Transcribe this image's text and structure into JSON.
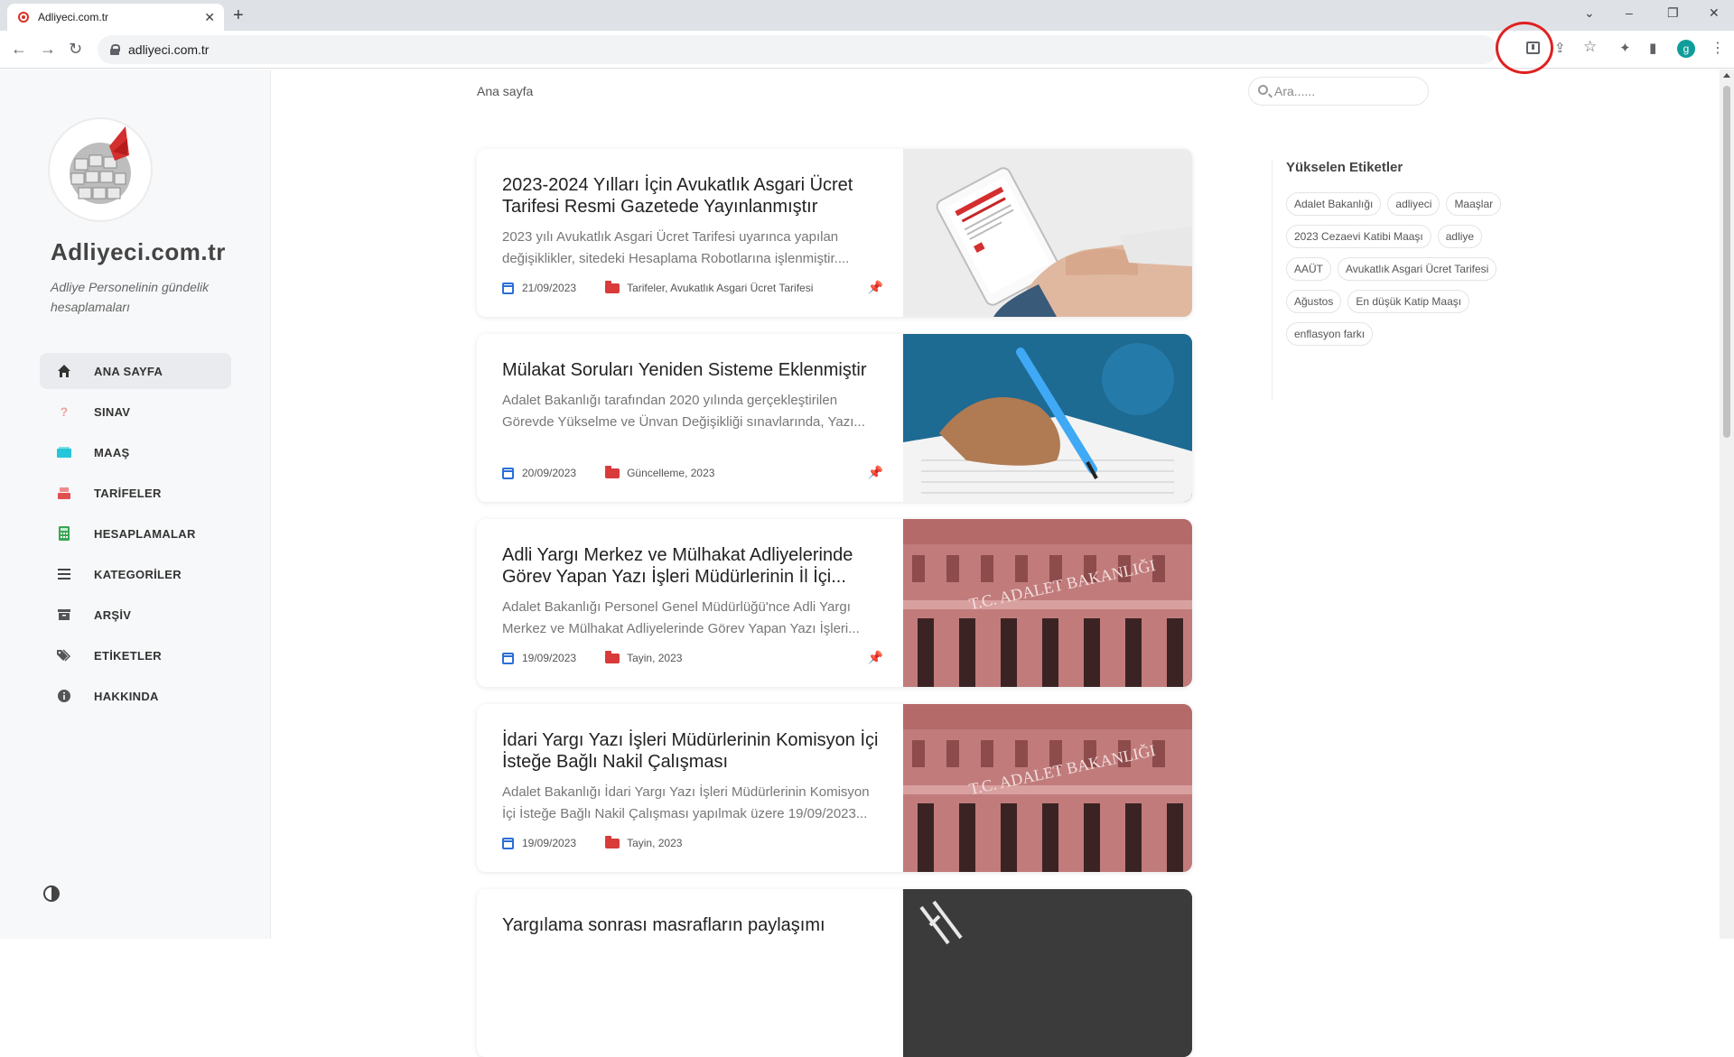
{
  "browser": {
    "tab_title": "Adliyeci.com.tr",
    "tab_close": "✕",
    "new_tab": "+",
    "url": "adliyeci.com.tr",
    "window_controls": {
      "chevron": "⌄",
      "minimize": "–",
      "restore": "❐",
      "close": "✕"
    },
    "nav": {
      "back": "←",
      "forward": "→",
      "reload": "↻"
    },
    "toolbar_icons": {
      "share": "⇪",
      "star": "☆",
      "extensions": "✦",
      "sidepanel": "▮",
      "menu": "⋮"
    },
    "profile_initial": "g",
    "highlight_color": "#e02020"
  },
  "sidebar": {
    "site_name": "Adliyeci.com.tr",
    "site_description": "Adliye Personelinin gündelik hesaplamaları",
    "menu": [
      {
        "label": "ANA SAYFA",
        "icon": "home-icon",
        "glyph": "⌂",
        "color": "#333333",
        "active": true
      },
      {
        "label": "SINAV",
        "icon": "question-icon",
        "glyph": "?",
        "color": "#f2a0a0",
        "active": false
      },
      {
        "label": "MAAŞ",
        "icon": "money-icon",
        "glyph": "▬",
        "color": "#26c6da",
        "active": false
      },
      {
        "label": "TARİFELER",
        "icon": "cash-register-icon",
        "glyph": "▤",
        "color": "#e05050",
        "active": false
      },
      {
        "label": "HESAPLAMALAR",
        "icon": "calculator-icon",
        "glyph": "▦",
        "color": "#3aa655",
        "active": false
      },
      {
        "label": "KATEGORİLER",
        "icon": "list-icon",
        "glyph": "≡",
        "color": "#444444",
        "active": false
      },
      {
        "label": "ARŞİV",
        "icon": "archive-icon",
        "glyph": "▭",
        "color": "#555555",
        "active": false
      },
      {
        "label": "ETİKETLER",
        "icon": "tags-icon",
        "glyph": "◆",
        "color": "#555555",
        "active": false
      },
      {
        "label": "HAKKINDA",
        "icon": "info-icon",
        "glyph": "i",
        "color": "#555555",
        "active": false
      }
    ]
  },
  "header": {
    "breadcrumb": "Ana sayfa",
    "search_placeholder": "Ara......"
  },
  "posts": [
    {
      "title": "2023-2024 Yılları İçin Avukatlık Asgari Ücret Tarifesi Resmi Gazetede Yayınlanmıştır",
      "excerpt": "2023 yılı Avukatlık Asgari Ücret Tarifesi uyarınca yapılan değişiklikler, sitedeki Hesaplama Robotlarına işlenmiştir....",
      "date": "21/09/2023",
      "categories": "Tarifeler, Avukatlık Asgari Ücret Tarifesi",
      "pinned": true,
      "image": "tablet-gazette"
    },
    {
      "title": "Mülakat Soruları Yeniden Sisteme Eklenmiştir",
      "excerpt": "Adalet Bakanlığı tarafından 2020 yılında gerçekleştirilen Görevde Yükselme ve Ünvan Değişikliği sınavlarında, Yazı...",
      "date": "20/09/2023",
      "categories": "Güncelleme, 2023",
      "pinned": true,
      "image": "hand-writing"
    },
    {
      "title": "Adli Yargı Merkez ve Mülhakat Adliyelerinde Görev Yapan Yazı İşleri Müdürlerinin İl İçi...",
      "excerpt": "Adalet Bakanlığı Personel Genel Müdürlüğü'nce Adli Yargı Merkez ve Mülhakat Adliyelerinde Görev Yapan Yazı İşleri...",
      "date": "19/09/2023",
      "categories": "Tayin, 2023",
      "pinned": true,
      "image": "ministry-building",
      "image_text": "T.C. ADALET BAKANLIĞI"
    },
    {
      "title": "İdari Yargı Yazı İşleri Müdürlerinin Komisyon İçi İsteğe Bağlı Nakil Çalışması",
      "excerpt": "Adalet Bakanlığı İdari Yargı Yazı İşleri Müdürlerinin Komisyon İçi İsteğe Bağlı Nakil Çalışması yapılmak üzere 19/09/2023...",
      "date": "19/09/2023",
      "categories": "Tayin, 2023",
      "pinned": false,
      "image": "ministry-building",
      "image_text": "T.C. ADALET BAKANLIĞI"
    },
    {
      "title": "Yargılama sonrası masrafların paylaşımı",
      "excerpt": "",
      "date": "",
      "categories": "",
      "pinned": false,
      "image": "chalkboard"
    }
  ],
  "aside": {
    "heading": "Yükselen Etiketler",
    "tags": [
      "Adalet Bakanlığı",
      "adliyeci",
      "Maaşlar",
      "2023 Cezaevi Katibi Maaşı",
      "adliye",
      "AAÜT",
      "Avukatlık Asgari Ücret Tarifesi",
      "Ağustos",
      "En düşük Katip Maaşı",
      "enflasyon farkı"
    ]
  },
  "colors": {
    "accent_pin": "#f0b400",
    "calendar_icon": "#2a6fd6",
    "folder_icon": "#d93a3a"
  }
}
